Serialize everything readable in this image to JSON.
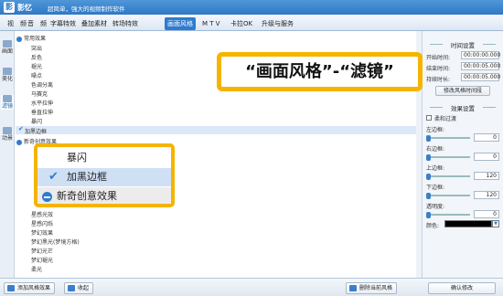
{
  "app": {
    "name": "影忆",
    "description": "超简单，强大的视频制作软件"
  },
  "menu": {
    "tabs": [
      "视　频",
      "音　频",
      "字幕特效",
      "叠加素材",
      "转场特效",
      "画面风格",
      "M T V",
      "卡拉OK",
      "升级与服务"
    ],
    "active": "画面风格"
  },
  "sidebar": {
    "items": [
      "画面",
      "美化",
      "滤镜",
      "动景"
    ],
    "active": "滤镜"
  },
  "list": {
    "group1": "常用效果",
    "items": [
      "突出",
      "反色",
      "褪光",
      "噪点",
      "色调分离",
      "马赛克",
      "水平拉伸",
      "垂直拉伸",
      "暴闪"
    ],
    "selected": "加黑边框",
    "group2": "新奇创意效果",
    "items2": [
      "星感光效",
      "星感闪烁",
      "梦幻效果",
      "梦幻黑光(梦境方格)",
      "梦幻光芒",
      "梦幻褪光",
      "柔光"
    ]
  },
  "callout": {
    "text": "“画面风格”-“滤镜”"
  },
  "zoom": {
    "item_above": "暴闪",
    "item_selected": "加黑边框",
    "group_below": "新奇创意效果"
  },
  "right_panel": {
    "time_section": "时间设置",
    "start_label": "开始时间:",
    "start_value": "00:00:00.000",
    "end_label": "结束时间:",
    "end_value": "00:00:05.000",
    "duration_label": "持续时长:",
    "duration_value": "00:00:05.000",
    "fix_button": "修改风格时间段",
    "effect_section": "效果设置",
    "soft_edge": "柔和过渡",
    "left_label": "左边框:",
    "left_value": "0",
    "right_label": "右边框:",
    "right_value": "0",
    "top_label": "上边框:",
    "top_value": "120",
    "bottom_label": "下边框:",
    "bottom_value": "120",
    "opacity_label": "透明度:",
    "opacity_value": "0",
    "color_label": "颜色:",
    "color_value": "#000000"
  },
  "bottom": {
    "add_button": "添加风格效果",
    "collect_button": "收起",
    "delete_button": "删除当前风格",
    "confirm_button": "确认修改"
  },
  "colors": {
    "accent": "#2e7bcf",
    "highlight": "#f4b400"
  }
}
